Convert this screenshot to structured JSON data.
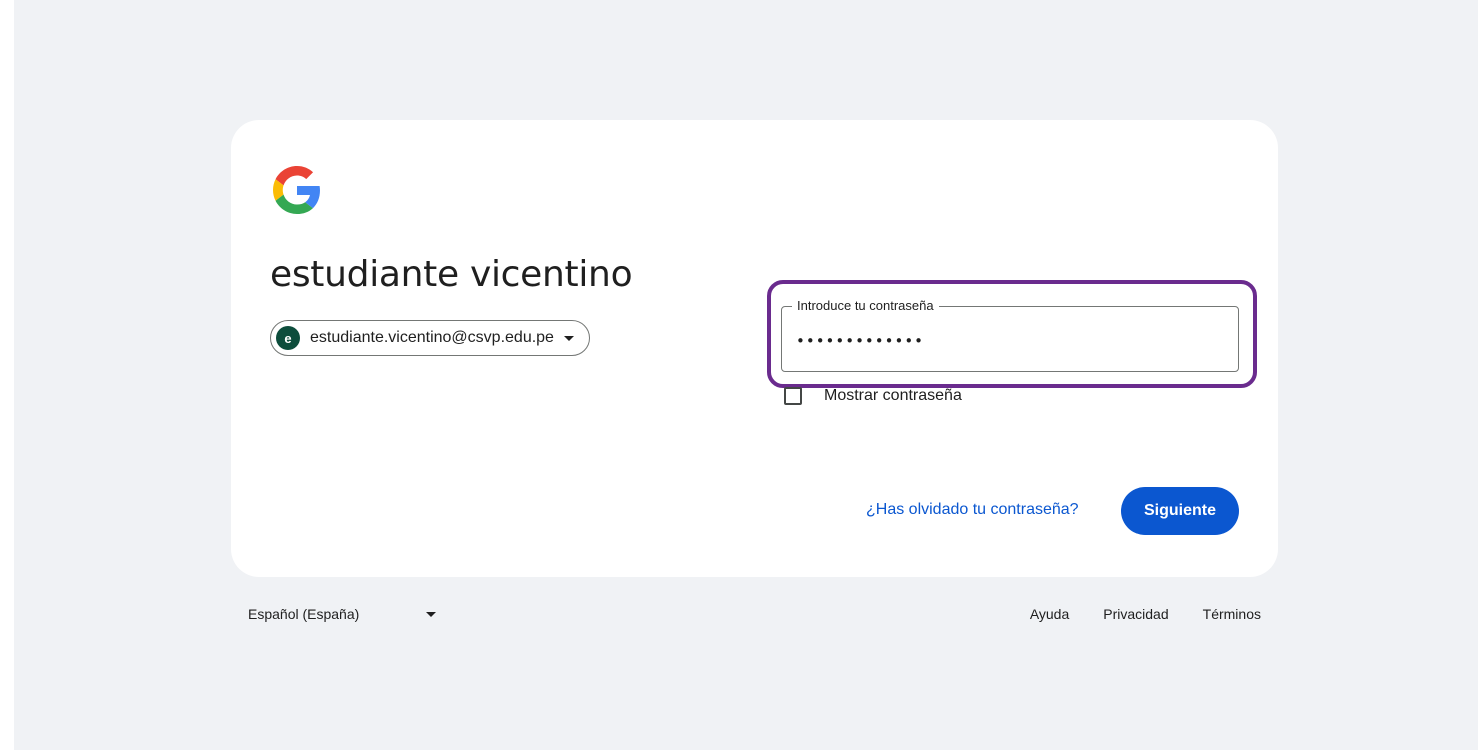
{
  "header": {
    "title": "estudiante vicentino"
  },
  "account": {
    "avatar_letter": "e",
    "avatar_color": "#0d4d3c",
    "email": "estudiante.vicentino@csvp.edu.pe"
  },
  "password": {
    "label": "Introduce tu contraseña",
    "value": "•••••••••••••",
    "show_label": "Mostrar contraseña",
    "show_checked": false
  },
  "actions": {
    "forgot_label": "¿Has olvidado tu contraseña?",
    "next_label": "Siguiente"
  },
  "footer": {
    "language": "Español (España)",
    "links": [
      "Ayuda",
      "Privacidad",
      "Términos"
    ]
  },
  "colors": {
    "accent": "#0b57d0",
    "highlight": "#6a2b8e",
    "page_background": "#f0f2f5"
  },
  "icons": {
    "logo": "google-g-logo-icon",
    "caret": "chevron-down-icon"
  }
}
